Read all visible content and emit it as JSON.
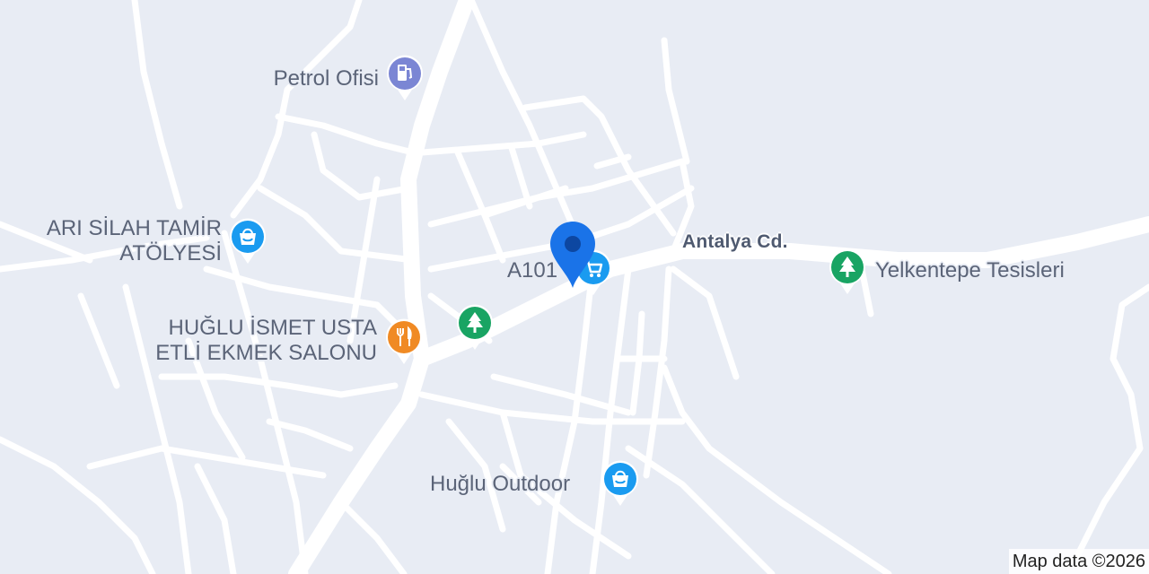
{
  "map": {
    "background_color": "#e8ecf4",
    "road_color": "#ffffff",
    "marker_color": "#1a73e8"
  },
  "road_labels": {
    "antalya_cd": "Antalya Cd."
  },
  "pois": [
    {
      "id": "petrol-ofisi",
      "label": "Petrol Ofisi",
      "icon": "gas-station-icon",
      "color": "#7b86d4"
    },
    {
      "id": "ari-silah",
      "label_line1": "ARI SİLAH TAMİR",
      "label_line2": "ATÖLYESİ",
      "icon": "shopping-bag-icon",
      "color": "#1a9bf0"
    },
    {
      "id": "a101",
      "label": "A101",
      "icon": "shopping-cart-icon",
      "color": "#1a9bf0"
    },
    {
      "id": "yelkentepe",
      "label": "Yelkentepe Tesisleri",
      "icon": "tree-icon",
      "color": "#19a463"
    },
    {
      "id": "park",
      "label": "",
      "icon": "tree-icon",
      "color": "#19a463"
    },
    {
      "id": "huglu-ismet",
      "label_line1": "HUĞLU İSMET USTA",
      "label_line2": "ETLİ EKMEK SALONU",
      "icon": "restaurant-icon",
      "color": "#f08a24"
    },
    {
      "id": "huglu-outdoor",
      "label": "Huğlu Outdoor",
      "icon": "shopping-bag-icon",
      "color": "#1a9bf0"
    }
  ],
  "attribution": "Map data ©2026"
}
